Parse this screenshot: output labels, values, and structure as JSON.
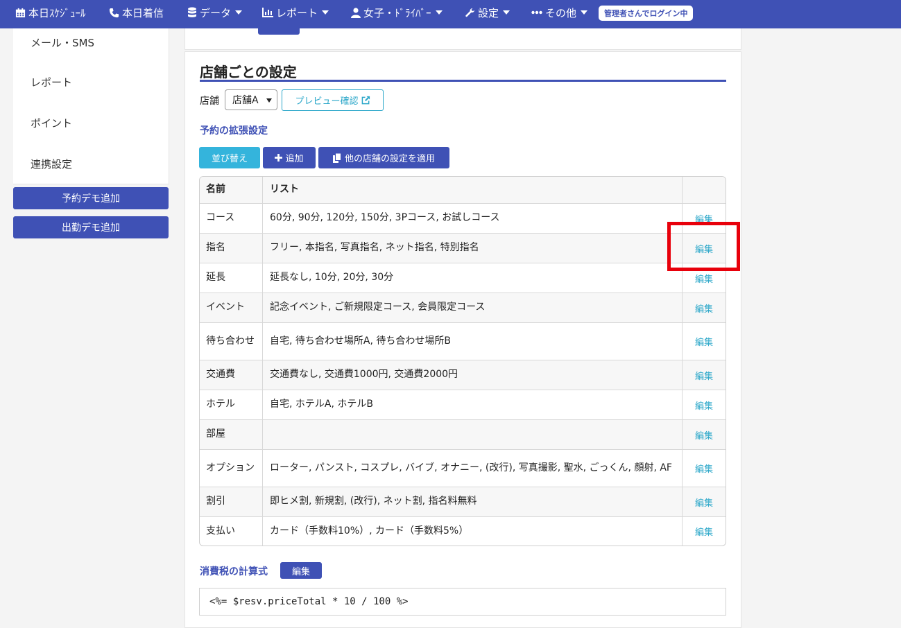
{
  "nav": {
    "items": [
      {
        "label": "本日ｽｹｼﾞｭｰﾙ",
        "icon": "calendar-icon",
        "caret": false
      },
      {
        "label": "本日着信",
        "icon": "phone-icon",
        "caret": false
      },
      {
        "label": "データ",
        "icon": "database-icon",
        "caret": true
      },
      {
        "label": "レポート",
        "icon": "chart-icon",
        "caret": true
      },
      {
        "label": "女子・ﾄﾞﾗｲﾊﾞｰ",
        "icon": "user-icon",
        "caret": true
      },
      {
        "label": "設定",
        "icon": "wrench-icon",
        "caret": true
      },
      {
        "label": "その他",
        "icon": "ellipsis-icon",
        "caret": true
      }
    ],
    "login_badge": "管理者さんでログイン中"
  },
  "sidebar": {
    "items": [
      {
        "label": "メール・SMS"
      },
      {
        "label": "レポート"
      },
      {
        "label": "ポイント"
      },
      {
        "label": "連携設定"
      }
    ],
    "buttons": [
      {
        "label": "予約デモ追加"
      },
      {
        "label": "出勤デモ追加"
      }
    ]
  },
  "main": {
    "section_title": "店舗ごとの設定",
    "store_label": "店舗",
    "store_select_value": "店舗A",
    "preview_button": "プレビュー確認",
    "subsection_title": "予約の拡張設定",
    "buttons": {
      "sort": "並び替え",
      "add": "追加",
      "apply_other": "他の店舗の設定を適用"
    },
    "table": {
      "headers": {
        "name": "名前",
        "list": "リスト",
        "action": ""
      },
      "rows": [
        {
          "name": "コース",
          "list": "60分, 90分, 120分, 150分, 3Pコース, お試しコース",
          "action": "編集"
        },
        {
          "name": "指名",
          "list": "フリー, 本指名, 写真指名, ネット指名, 特別指名",
          "action": "編集"
        },
        {
          "name": "延長",
          "list": "延長なし, 10分, 20分, 30分",
          "action": "編集"
        },
        {
          "name": "イベント",
          "list": "記念イベント, ご新規限定コース, 会員限定コース",
          "action": "編集"
        },
        {
          "name": "待ち合わせ",
          "list": "自宅, 待ち合わせ場所A, 待ち合わせ場所B",
          "action": "編集"
        },
        {
          "name": "交通費",
          "list": "交通費なし, 交通費1000円, 交通費2000円",
          "action": "編集"
        },
        {
          "name": "ホテル",
          "list": "自宅, ホテルA, ホテルB",
          "action": "編集"
        },
        {
          "name": "部屋",
          "list": "",
          "action": "編集"
        },
        {
          "name": "オプション",
          "list": "ローター, パンスト, コスプレ, バイブ, オナニー, (改行), 写真撮影, 聖水, ごっくん, 顔射, AF",
          "action": "編集"
        },
        {
          "name": "割引",
          "list": "即ヒメ割, 新規割, (改行), ネット割, 指名料無料",
          "action": "編集"
        },
        {
          "name": "支払い",
          "list": "カード（手数料10%）, カード（手数料5%）",
          "action": "編集"
        }
      ]
    },
    "tax": {
      "title": "消費税の計算式",
      "edit_button": "編集",
      "formula": "<%= $resv.priceTotal * 10 / 100 %>"
    }
  },
  "colors": {
    "primary": "#3f51b5",
    "info": "#2ba7c9",
    "highlight": "#e8000b"
  }
}
